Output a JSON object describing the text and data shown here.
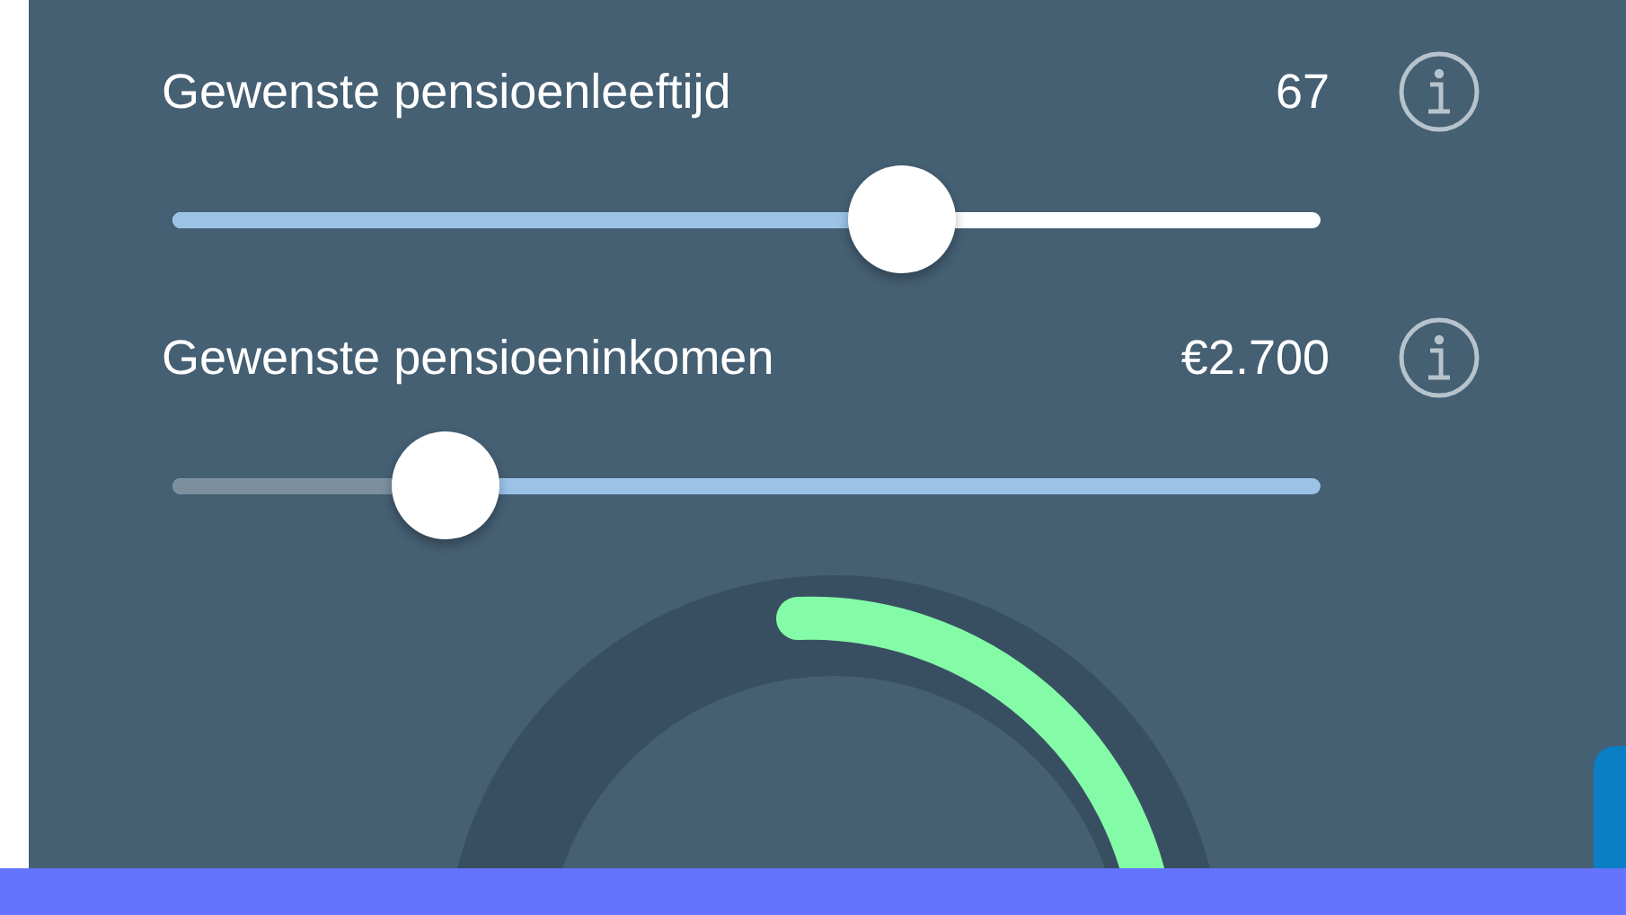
{
  "sliders": [
    {
      "label": "Gewenste pensioenleeftijd",
      "value": "67",
      "level": 0.65,
      "kind": "filled"
    },
    {
      "label": "Gewenste pensioeninkomen",
      "value": "€2.700",
      "level": 0.21,
      "kind": "remaining"
    }
  ]
}
